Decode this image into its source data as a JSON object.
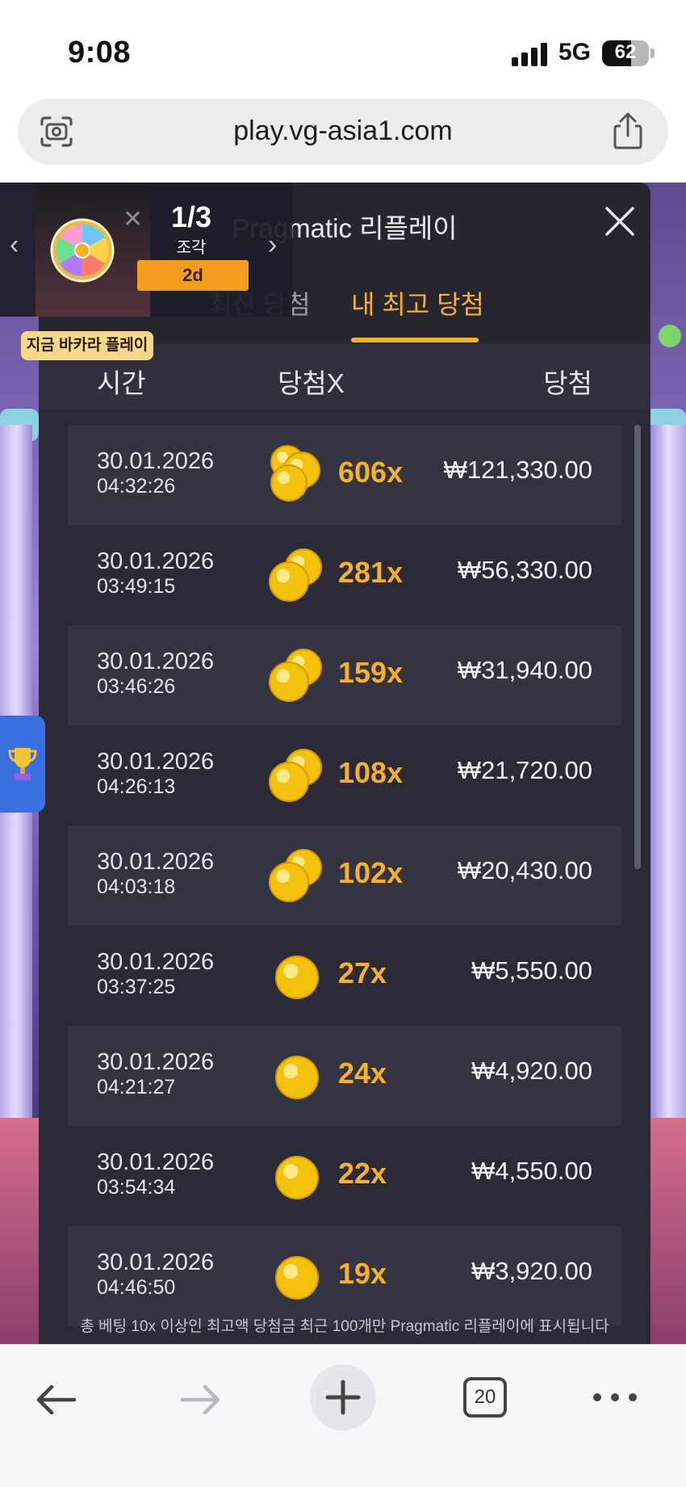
{
  "status_bar": {
    "time": "9:08",
    "network": "5G",
    "battery": "62",
    "battery_level": 0.62
  },
  "browser": {
    "url": "play.vg-asia1.com",
    "tab_count": "20"
  },
  "promo": {
    "count": "1/3",
    "unit": "조각",
    "timer": "2d",
    "banner": "지금 바카라 플레이"
  },
  "modal": {
    "title": "Pragmatic 리플레이",
    "tabs": {
      "recent": "최신 당첨",
      "best": "내 최고 당첨"
    },
    "columns": {
      "time": "시간",
      "multiplier": "당첨X",
      "win": "당첨"
    },
    "rows": [
      {
        "date": "30.01.2026",
        "time": "04:32:26",
        "multiplier": "606x",
        "win": "₩121,330.00",
        "coins": 3
      },
      {
        "date": "30.01.2026",
        "time": "03:49:15",
        "multiplier": "281x",
        "win": "₩56,330.00",
        "coins": 2
      },
      {
        "date": "30.01.2026",
        "time": "03:46:26",
        "multiplier": "159x",
        "win": "₩31,940.00",
        "coins": 2
      },
      {
        "date": "30.01.2026",
        "time": "04:26:13",
        "multiplier": "108x",
        "win": "₩21,720.00",
        "coins": 2
      },
      {
        "date": "30.01.2026",
        "time": "04:03:18",
        "multiplier": "102x",
        "win": "₩20,430.00",
        "coins": 2
      },
      {
        "date": "30.01.2026",
        "time": "03:37:25",
        "multiplier": "27x",
        "win": "₩5,550.00",
        "coins": 1
      },
      {
        "date": "30.01.2026",
        "time": "04:21:27",
        "multiplier": "24x",
        "win": "₩4,920.00",
        "coins": 1
      },
      {
        "date": "30.01.2026",
        "time": "03:54:34",
        "multiplier": "22x",
        "win": "₩4,550.00",
        "coins": 1
      },
      {
        "date": "30.01.2026",
        "time": "04:46:50",
        "multiplier": "19x",
        "win": "₩3,920.00",
        "coins": 1
      }
    ],
    "footer": "총 베팅 10x 이상인 최고액 당첨금 최근 100개만 Pragmatic 리플레이에 표시됩니다"
  },
  "colors": {
    "accent": "#f8b02b",
    "modal_bg": "#2a2b36",
    "coin": "#f4c20d"
  },
  "icons": [
    "camera-scan-icon",
    "share-icon",
    "close-icon",
    "chevron-left-icon",
    "chevron-right-icon",
    "prize-wheel-icon",
    "trophy-icon",
    "coin-icon",
    "back-arrow-icon",
    "forward-arrow-icon",
    "plus-icon",
    "more-icon"
  ]
}
